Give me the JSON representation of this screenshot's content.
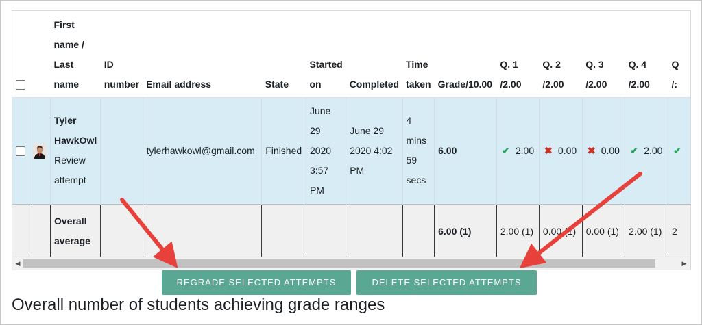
{
  "table": {
    "headers": {
      "name_line1": "First",
      "name_line2": "name /",
      "name_line3": "Last",
      "name_line4": "name",
      "id_line1": "ID",
      "id_line2": "number",
      "email": "Email address",
      "state": "State",
      "started_line1": "Started",
      "started_line2": "on",
      "completed": "Completed",
      "time_line1": "Time",
      "time_line2": "taken",
      "grade": "Grade/10.00",
      "q1_line1": "Q. 1",
      "q1_line2": "/2.00",
      "q2_line1": "Q. 2",
      "q2_line2": "/2.00",
      "q3_line1": "Q. 3",
      "q3_line2": "/2.00",
      "q4_line1": "Q. 4",
      "q4_line2": "/2.00",
      "q5_line1": "Q",
      "q5_line2": "/:"
    },
    "row": {
      "first_name": "Tyler",
      "last_name": "HawkOwl",
      "review_line1": "Review",
      "review_line2": "attempt",
      "email": "tylerhawkowl@gmail.com",
      "state": "Finished",
      "started_line1": "June",
      "started_line2": "29",
      "started_line3": "2020",
      "started_line4": "3:57",
      "started_line5": "PM",
      "completed_line1": "June 29",
      "completed_line2": "2020 4:02",
      "completed_line3": "PM",
      "time_line1": "4",
      "time_line2": "mins",
      "time_line3": "59",
      "time_line4": "secs",
      "grade": "6.00",
      "q1": "2.00",
      "q2": "0.00",
      "q3": "0.00",
      "q4": "2.00",
      "marks": {
        "correct": "✔",
        "incorrect": "✖"
      }
    },
    "average": {
      "label_line1": "Overall",
      "label_line2": "average",
      "grade": "6.00 (1)",
      "q1": "2.00 (1)",
      "q2": "0.00 (1)",
      "q3": "0.00 (1)",
      "q4": "2.00 (1)",
      "q5": "2"
    }
  },
  "scrollbar": {
    "left_arrow": "◀",
    "right_arrow": "▶"
  },
  "buttons": {
    "regrade": "REGRADE SELECTED ATTEMPTS",
    "delete": "DELETE SELECTED ATTEMPTS"
  },
  "section_heading": "Overall number of students achieving grade ranges",
  "colors": {
    "selected_row": "#d8ecf6",
    "button": "#5aa893",
    "correct": "#26a65b",
    "incorrect": "#ca3120",
    "annotation_arrow": "#e8413b"
  }
}
